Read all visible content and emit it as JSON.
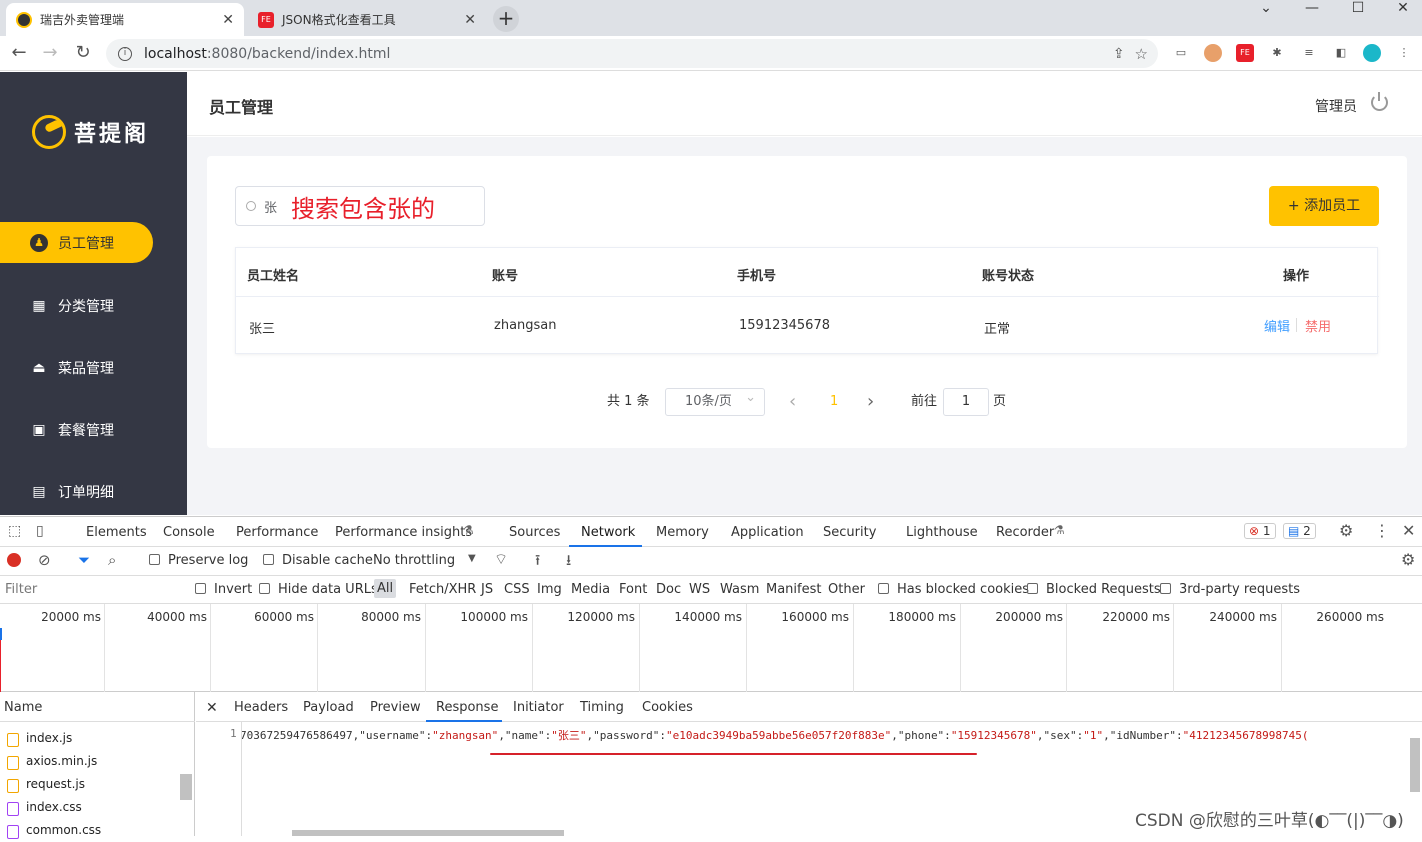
{
  "browser": {
    "tabs": [
      {
        "title": "瑞吉外卖管理端",
        "active": true
      },
      {
        "title": "JSON格式化查看工具",
        "active": false
      }
    ],
    "new_tab": "+",
    "url_host": "localhost",
    "url_path": ":8080/backend/index.html",
    "window_controls": [
      "⌄",
      "—",
      "☐",
      "✕"
    ]
  },
  "app": {
    "logo_text": "菩提阁",
    "page_title": "员工管理",
    "user_label": "管理员",
    "sidebar": [
      {
        "label": "员工管理",
        "icon": "person-icon",
        "active": true
      },
      {
        "label": "分类管理",
        "icon": "category-icon",
        "active": false
      },
      {
        "label": "菜品管理",
        "icon": "dish-icon",
        "active": false
      },
      {
        "label": "套餐管理",
        "icon": "gift-icon",
        "active": false
      },
      {
        "label": "订单明细",
        "icon": "clipboard-icon",
        "active": false
      }
    ],
    "search": {
      "value": "张",
      "annotation": "搜索包含张的"
    },
    "add_button": "+ 添加员工",
    "table": {
      "headers": [
        "员工姓名",
        "账号",
        "手机号",
        "账号状态",
        "操作"
      ],
      "rows": [
        {
          "name": "张三",
          "account": "zhangsan",
          "phone": "15912345678",
          "status": "正常",
          "edit": "编辑",
          "disable": "禁用"
        }
      ]
    },
    "pagination": {
      "total": "共 1 条",
      "page_size": "10条/页",
      "prev": "‹",
      "current": "1",
      "next": "›",
      "goto_label": "前往",
      "goto_value": "1",
      "page_unit": "页"
    }
  },
  "devtools": {
    "tabs": [
      "Elements",
      "Console",
      "Performance",
      "Performance insights",
      "Sources",
      "Network",
      "Memory",
      "Application",
      "Security",
      "Lighthouse",
      "Recorder"
    ],
    "active_tab": "Network",
    "errors": "1",
    "messages": "2",
    "toolbar": {
      "preserve_log": "Preserve log",
      "disable_cache": "Disable cache",
      "throttling": "No throttling"
    },
    "filter": {
      "placeholder": "Filter",
      "invert": "Invert",
      "hide_data_urls": "Hide data URLs",
      "types": [
        "All",
        "Fetch/XHR",
        "JS",
        "CSS",
        "Img",
        "Media",
        "Font",
        "Doc",
        "WS",
        "Wasm",
        "Manifest",
        "Other"
      ],
      "has_blocked_cookies": "Has blocked cookies",
      "blocked_requests": "Blocked Requests",
      "third_party": "3rd-party requests"
    },
    "timeline_ticks": [
      "20000 ms",
      "40000 ms",
      "60000 ms",
      "80000 ms",
      "100000 ms",
      "120000 ms",
      "140000 ms",
      "160000 ms",
      "180000 ms",
      "200000 ms",
      "220000 ms",
      "240000 ms",
      "260000 ms"
    ],
    "requests_header": "Name",
    "requests": [
      {
        "name": "index.js",
        "type": "js"
      },
      {
        "name": "axios.min.js",
        "type": "js"
      },
      {
        "name": "request.js",
        "type": "js"
      },
      {
        "name": "index.css",
        "type": "css"
      },
      {
        "name": "common.css",
        "type": "css"
      }
    ],
    "detail_tabs": [
      "Headers",
      "Payload",
      "Preview",
      "Response",
      "Initiator",
      "Timing",
      "Cookies"
    ],
    "active_detail_tab": "Response",
    "line_number": "1",
    "response_parts": [
      {
        "t": "k",
        "v": "70367259476586497,"
      },
      {
        "t": "k",
        "v": "\"username\":"
      },
      {
        "t": "s",
        "v": "\"zhangsan\""
      },
      {
        "t": "k",
        "v": ",\"name\":"
      },
      {
        "t": "s",
        "v": "\"张三\""
      },
      {
        "t": "k",
        "v": ",\"password\":"
      },
      {
        "t": "s",
        "v": "\"e10adc3949ba59abbe56e057f20f883e\""
      },
      {
        "t": "k",
        "v": ",\"phone\":"
      },
      {
        "t": "s",
        "v": "\"15912345678\""
      },
      {
        "t": "k",
        "v": ",\"sex\":"
      },
      {
        "t": "s",
        "v": "\"1\""
      },
      {
        "t": "k",
        "v": ",\"idNumber\":"
      },
      {
        "t": "s",
        "v": "\"41212345678998745("
      }
    ]
  },
  "watermark": "CSDN @欣慰的三叶草(◐‾‾(|)‾‾◑)",
  "colors": {
    "accent": "#ffc200",
    "sidebar": "#343744",
    "link": "#419eff",
    "danger": "#f56c6c",
    "annotation": "#e8202b"
  }
}
